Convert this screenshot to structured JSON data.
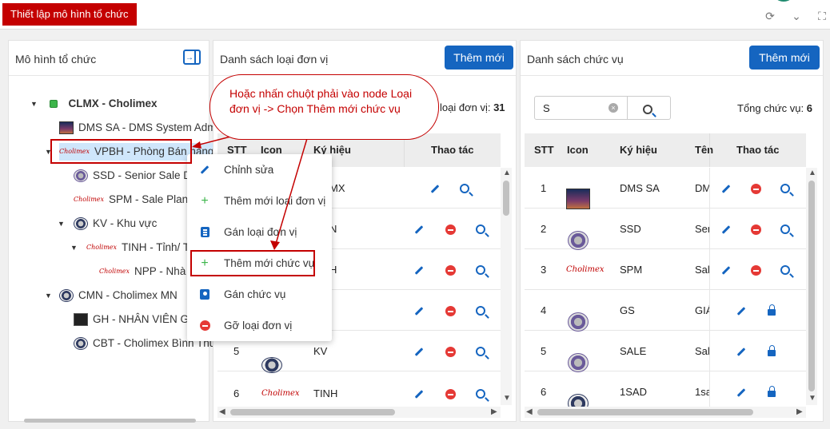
{
  "title_tab": "Thiết lập mô hình tổ chức",
  "org_panel": {
    "title": "Mô hình tổ chức"
  },
  "tree": [
    {
      "label": "CLMX - Cholimex",
      "bold": true
    },
    {
      "label": "DMS SA - DMS System Adm"
    },
    {
      "label": "VPBH - Phòng Bán hàng"
    },
    {
      "label": "SSD - Senior Sale Dir"
    },
    {
      "label": "SPM - Sale Planning"
    },
    {
      "label": "KV - Khu vực"
    },
    {
      "label": "TINH - Tỉnh/ Thàn"
    },
    {
      "label": "NPP - Nhà phâ"
    },
    {
      "label": "CMN - Cholimex MN"
    },
    {
      "label": "GH - NHÂN VIÊN GI"
    },
    {
      "label": "CBT - Cholimex Bình Thuậ"
    }
  ],
  "logo_text": "Cholimex",
  "unit_panel": {
    "title": "Danh sách loại đơn vị",
    "add_button": "Thêm mới",
    "total_label": "loại đơn vị:",
    "total_value": "31",
    "columns": {
      "stt": "STT",
      "icon": "Icon",
      "code": "Ký hiệu",
      "actions": "Thao tác"
    },
    "rows": [
      {
        "stt": "",
        "code": "MX"
      },
      {
        "stt": "",
        "code": "N"
      },
      {
        "stt": "",
        "code": "H"
      },
      {
        "stt": "",
        "code": ""
      },
      {
        "stt": "5",
        "code": "KV"
      },
      {
        "stt": "6",
        "code": "TINH"
      }
    ]
  },
  "position_panel": {
    "title": "Danh sách chức vụ",
    "add_button": "Thêm mới",
    "search_value": "S",
    "total_label": "Tổng chức vụ:",
    "total_value": "6",
    "columns": {
      "stt": "STT",
      "icon": "Icon",
      "code": "Ký hiệu",
      "name": "Tên",
      "actions": "Thao tác"
    },
    "rows": [
      {
        "stt": "1",
        "code": "DMS SA",
        "name": "DM"
      },
      {
        "stt": "2",
        "code": "SSD",
        "name": "Sen"
      },
      {
        "stt": "3",
        "code": "SPM",
        "name": "Sale"
      },
      {
        "stt": "4",
        "code": "GS",
        "name": "GIÁ"
      },
      {
        "stt": "5",
        "code": "SALE",
        "name": "Sale"
      },
      {
        "stt": "6",
        "code": "1SAD",
        "name": "1sa"
      }
    ]
  },
  "context_menu": [
    {
      "label": "Chỉnh sửa",
      "icon": "pencil-icon"
    },
    {
      "label": "Thêm mới loại đơn vị",
      "icon": "plus-icon"
    },
    {
      "label": "Gán loại đơn vị",
      "icon": "clipboard-icon"
    },
    {
      "label": "Thêm mới chức vụ",
      "icon": "plus-icon"
    },
    {
      "label": "Gán chức vụ",
      "icon": "badge-icon"
    },
    {
      "label": "Gỡ loại đơn vị",
      "icon": "remove-icon"
    }
  ],
  "callout_text": "Hoặc nhấn chuột phải vào node Loại đơn vị -> Chọn Thêm mới chức vụ",
  "colors": {
    "brand_red": "#c40000",
    "primary_blue": "#1565c0",
    "danger": "#e53935",
    "plus_green": "#3cb54a"
  }
}
